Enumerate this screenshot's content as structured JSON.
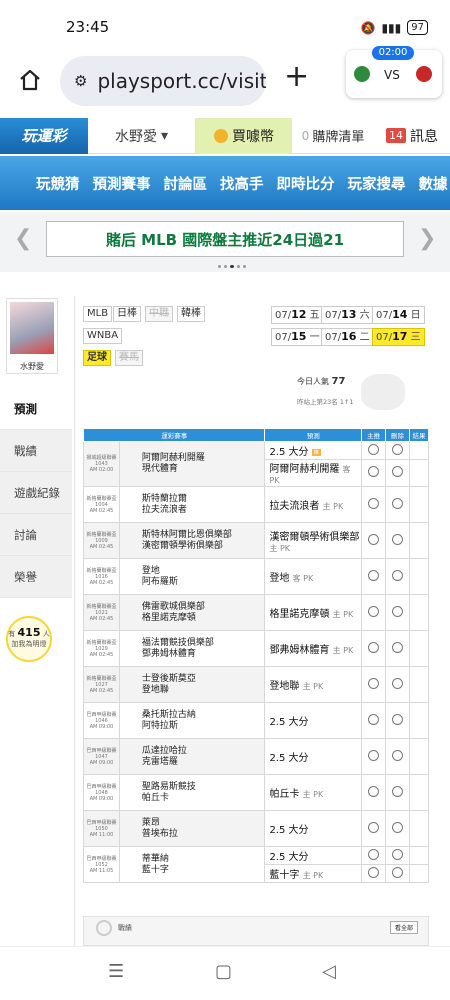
{
  "status": {
    "time": "23:45",
    "battery": "97"
  },
  "browser": {
    "url": "playsport.cc/visit",
    "new_tab": "+"
  },
  "scorecard": {
    "time": "02:00",
    "vs": "VS"
  },
  "topnav": {
    "logo": "玩運彩",
    "user": "水野愛",
    "buy": "買噱幣",
    "cart_count": "0",
    "cart": "購牌清單",
    "msg_count": "14",
    "msg": "訊息"
  },
  "mainnav": [
    "玩競猜",
    "預測賽事",
    "討論區",
    "找高手",
    "即時比分",
    "玩家搜尋",
    "數據"
  ],
  "banner": {
    "text": "賭后 MLB 國際盤主推近24日過21"
  },
  "sidebar": {
    "username": "水野愛",
    "items": [
      "預測",
      "戰績",
      "遊戲紀錄",
      "討論",
      "榮譽"
    ],
    "bulb_pre": "有",
    "bulb_count": "415",
    "bulb_post": "人",
    "bulb_line2": "加我為明燈"
  },
  "leagues": [
    {
      "label": "MLB",
      "state": "normal"
    },
    {
      "label": "日棒",
      "state": "normal"
    },
    {
      "label": "中職",
      "state": "dim"
    },
    {
      "label": "韓棒",
      "state": "normal"
    },
    {
      "label": "WNBA",
      "state": "normal"
    },
    {
      "label": "足球",
      "state": "sel"
    },
    {
      "label": "賽馬",
      "state": "dim"
    }
  ],
  "dates": [
    {
      "d": "07/",
      "dd": "12",
      "w": "五"
    },
    {
      "d": "07/",
      "dd": "13",
      "w": "六"
    },
    {
      "d": "07/",
      "dd": "14",
      "w": "日"
    },
    {
      "d": "07/",
      "dd": "15",
      "w": "一"
    },
    {
      "d": "07/",
      "dd": "16",
      "w": "二"
    },
    {
      "d": "07/",
      "dd": "17",
      "w": "三"
    }
  ],
  "popularity": {
    "label": "今日人氣",
    "value": "77",
    "rank": "昨站上第23名 1↑1"
  },
  "table": {
    "headers": [
      "運彩賽事",
      "預測",
      "主推",
      "刪除",
      "結果"
    ],
    "rows": [
      {
        "info": [
          "挪威超級聯賽",
          "1043",
          "AM 02:00"
        ],
        "teams": [
          "阿爾阿赫利開羅",
          "現代體育"
        ],
        "preds": [
          {
            "t": "2.5 大分",
            "s": "",
            "tag": "推"
          },
          {
            "t": "阿爾阿赫利開羅",
            "s": "客 PK",
            "tag": ""
          }
        ]
      },
      {
        "info": [
          "新格蘭聯賽盃",
          "1004",
          "AM 02:45"
        ],
        "teams": [
          "斯特蘭拉爾",
          "拉夫流浪者"
        ],
        "preds": [
          {
            "t": "拉夫流浪者",
            "s": "主 PK",
            "tag": ""
          }
        ]
      },
      {
        "info": [
          "新格蘭聯賽盃",
          "1009",
          "AM 02:45"
        ],
        "teams": [
          "斯特林阿爾比恩俱樂部",
          "漢密爾頓學術俱樂部"
        ],
        "preds": [
          {
            "t": "漢密爾頓學術俱樂部",
            "s": "主 PK",
            "tag": ""
          }
        ]
      },
      {
        "info": [
          "新格蘭聯賽盃",
          "1016",
          "AM 02:45"
        ],
        "teams": [
          "登地",
          "阿布羅斯"
        ],
        "preds": [
          {
            "t": "登地",
            "s": "客 PK",
            "tag": ""
          }
        ]
      },
      {
        "info": [
          "新格蘭聯賽盃",
          "1021",
          "AM 02:45"
        ],
        "teams": [
          "佛雷歌城俱樂部",
          "格里諾克摩頓"
        ],
        "preds": [
          {
            "t": "格里諾克摩頓",
            "s": "主 PK",
            "tag": ""
          }
        ]
      },
      {
        "info": [
          "新格蘭聯賽盃",
          "1029",
          "AM 02:45"
        ],
        "teams": [
          "福法爾競技俱樂部",
          "鄧弗姆林體育"
        ],
        "preds": [
          {
            "t": "鄧弗姆林體育",
            "s": "主 PK",
            "tag": ""
          }
        ]
      },
      {
        "info": [
          "新格蘭聯賽盃",
          "1027",
          "AM 02:45"
        ],
        "teams": [
          "士登後斯莫亞",
          "登地聯"
        ],
        "preds": [
          {
            "t": "登地聯",
            "s": "主 PK",
            "tag": ""
          }
        ]
      },
      {
        "info": [
          "巴西甲級聯賽",
          "1046",
          "AM 09:00"
        ],
        "teams": [
          "桑托斯拉古納",
          "阿特拉斯"
        ],
        "preds": [
          {
            "t": "2.5 大分",
            "s": "",
            "tag": ""
          }
        ]
      },
      {
        "info": [
          "巴西甲級聯賽",
          "1047",
          "AM 09:00"
        ],
        "teams": [
          "瓜達拉哈拉",
          "克雷塔羅"
        ],
        "preds": [
          {
            "t": "2.5 大分",
            "s": "",
            "tag": ""
          }
        ]
      },
      {
        "info": [
          "巴西甲級聯賽",
          "1048",
          "AM 09:00"
        ],
        "teams": [
          "聖路易斯競技",
          "帕丘卡"
        ],
        "preds": [
          {
            "t": "帕丘卡",
            "s": "主 PK",
            "tag": ""
          }
        ]
      },
      {
        "info": [
          "巴西甲級聯賽",
          "1050",
          "AM 11:00"
        ],
        "teams": [
          "萊昂",
          "普埃布拉"
        ],
        "preds": [
          {
            "t": "2.5 大分",
            "s": "",
            "tag": ""
          }
        ]
      },
      {
        "info": [
          "巴西甲級聯賽",
          "1052",
          "AM 11:05"
        ],
        "teams": [
          "蒂華納",
          "藍十字"
        ],
        "preds": [
          {
            "t": "2.5 大分",
            "s": "",
            "tag": ""
          },
          {
            "t": "藍十字",
            "s": "主 PK",
            "tag": ""
          }
        ]
      }
    ]
  },
  "stats": {
    "title": "戰績",
    "button": "看全部"
  },
  "bottomnav": {
    "menu": "☰",
    "home": "▢",
    "back": "◁"
  }
}
